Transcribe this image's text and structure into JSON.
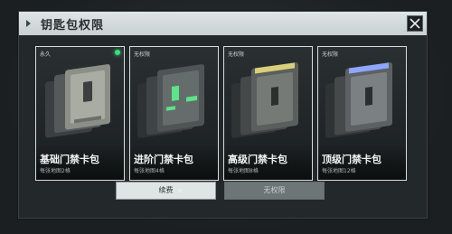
{
  "dialog": {
    "title": "钥匙包权限"
  },
  "cards": [
    {
      "tag": "永久",
      "name": "基础门禁卡包",
      "sub": "每张地图2格",
      "selected": true,
      "accent": "#9fb0a4"
    },
    {
      "tag": "无权限",
      "name": "进阶门禁卡包",
      "sub": "每张地图4格",
      "selected": false,
      "accent": "#5ee28a"
    },
    {
      "tag": "无权限",
      "name": "高级门禁卡包",
      "sub": "每张地图8格",
      "selected": false,
      "accent": "#d9cf7a"
    },
    {
      "tag": "无权限",
      "name": "顶级门禁卡包",
      "sub": "每张地图12格",
      "selected": false,
      "accent": "#8ea6ff"
    }
  ],
  "buttons": {
    "renew": "续费",
    "no_permission": "无权限"
  },
  "icons": {
    "close": "close-icon",
    "title_marker": "arrow-icon",
    "status_dot": "status-dot-icon"
  },
  "colors": {
    "title_bar": "#d6dcde",
    "card_border": "#d7dcdd",
    "status_dot": "#3ddc7a",
    "disabled_button": "#6e7577"
  }
}
